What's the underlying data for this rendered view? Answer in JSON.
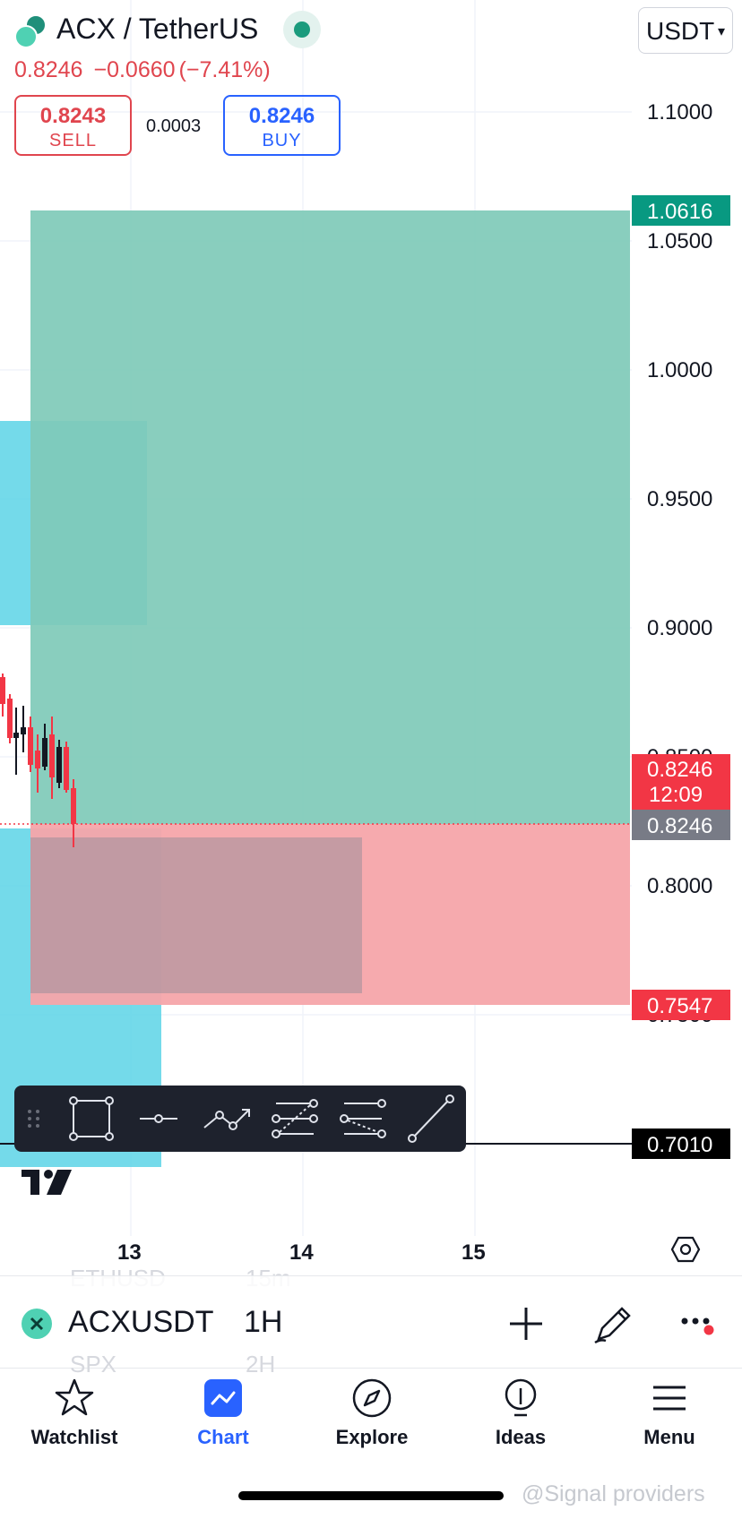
{
  "header": {
    "title": "ACX / TetherUS",
    "currency": "USDT",
    "last_price": "0.8246",
    "change": "−0.0660",
    "change_pct": "(−7.41%)",
    "sell": {
      "value": "0.8243",
      "label": "SELL"
    },
    "buy": {
      "value": "0.8246",
      "label": "BUY"
    },
    "spread": "0.0003"
  },
  "chart": {
    "y_ticks": [
      "1.1000",
      "1.0500",
      "1.0000",
      "0.9500",
      "0.9000",
      "0.8000"
    ],
    "partial_ticks": [
      "0.8500",
      "0.7500"
    ],
    "x_ticks": [
      "13",
      "14",
      "15"
    ],
    "target_price": "1.0616",
    "current_price": "0.8246",
    "countdown": "12:09",
    "line_price": "0.8246",
    "stop_price": "0.7547",
    "hline_price": "0.7010",
    "colors": {
      "profit_zone": "#7fcab9",
      "loss_zone": "#f6a5aa",
      "cyan_box": "#5cd3e6",
      "up_candle": "#131722",
      "down_candle": "#f23645",
      "badge_green": "#089981",
      "badge_red": "#f23645",
      "badge_gray": "#787b86"
    }
  },
  "draw_tools": [
    "drag-handle-icon",
    "rectangle-icon",
    "horizontal-ray-icon",
    "path-icon",
    "fib-retracement-icon",
    "fib-extension-icon",
    "trend-line-icon"
  ],
  "symbol_bar": {
    "symbol": "ACXUSDT",
    "interval": "1H",
    "ghost_above": {
      "symbol": "ETHUSD",
      "interval": "15m"
    },
    "ghost_below": {
      "symbol": "SPX",
      "interval": "2H"
    }
  },
  "nav": [
    {
      "label": "Watchlist",
      "icon": "star-icon"
    },
    {
      "label": "Chart",
      "icon": "chart-icon"
    },
    {
      "label": "Explore",
      "icon": "compass-icon"
    },
    {
      "label": "Ideas",
      "icon": "lightbulb-icon"
    },
    {
      "label": "Menu",
      "icon": "hamburger-icon"
    }
  ],
  "watermark": "@Signal providers"
}
